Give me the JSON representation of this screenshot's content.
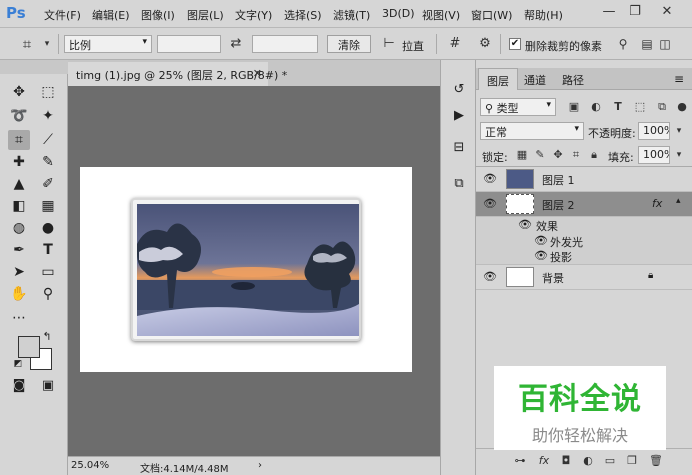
{
  "app": {
    "logo": "Ps"
  },
  "menu": [
    "文件(F)",
    "编辑(E)",
    "图像(I)",
    "图层(L)",
    "文字(Y)",
    "选择(S)",
    "滤镜(T)",
    "3D(D)",
    "视图(V)",
    "窗口(W)",
    "帮助(H)"
  ],
  "window_controls": {
    "minimize": "—",
    "restore": "❐",
    "close": "✕"
  },
  "options": {
    "ratio_label": "比例",
    "clear_label": "清除",
    "straighten_label": "拉直",
    "delete_cropped_label": "删除裁剪的像素",
    "delete_cropped_checked": true
  },
  "document": {
    "tab_title": "timg (1).jpg @ 25% (图层 2, RGB/8#) *",
    "zoom": "25.04%",
    "doc_info": "文档:4.14M/4.48M"
  },
  "layers_panel": {
    "tabs": [
      "图层",
      "通道",
      "路径"
    ],
    "filter_label": "类型",
    "blend_mode": "正常",
    "opacity_label": "不透明度:",
    "opacity_value": "100%",
    "lock_label": "锁定:",
    "fill_label": "填充:",
    "fill_value": "100%",
    "layers": [
      {
        "name": "图层 1",
        "selected": false
      },
      {
        "name": "图层 2",
        "selected": true,
        "fx": "fx"
      },
      {
        "name": "背景",
        "selected": false
      }
    ],
    "effects_label": "效果",
    "effects": [
      "外发光",
      "投影"
    ]
  },
  "watermark": {
    "title": "百科全说",
    "subtitle": "助你轻松解决"
  },
  "colors": {
    "accent": "#3a7fd5",
    "watermark_green": "#2fb534",
    "canvas_bg": "#6d6d6d",
    "panel_bg": "#d6d6d6"
  }
}
